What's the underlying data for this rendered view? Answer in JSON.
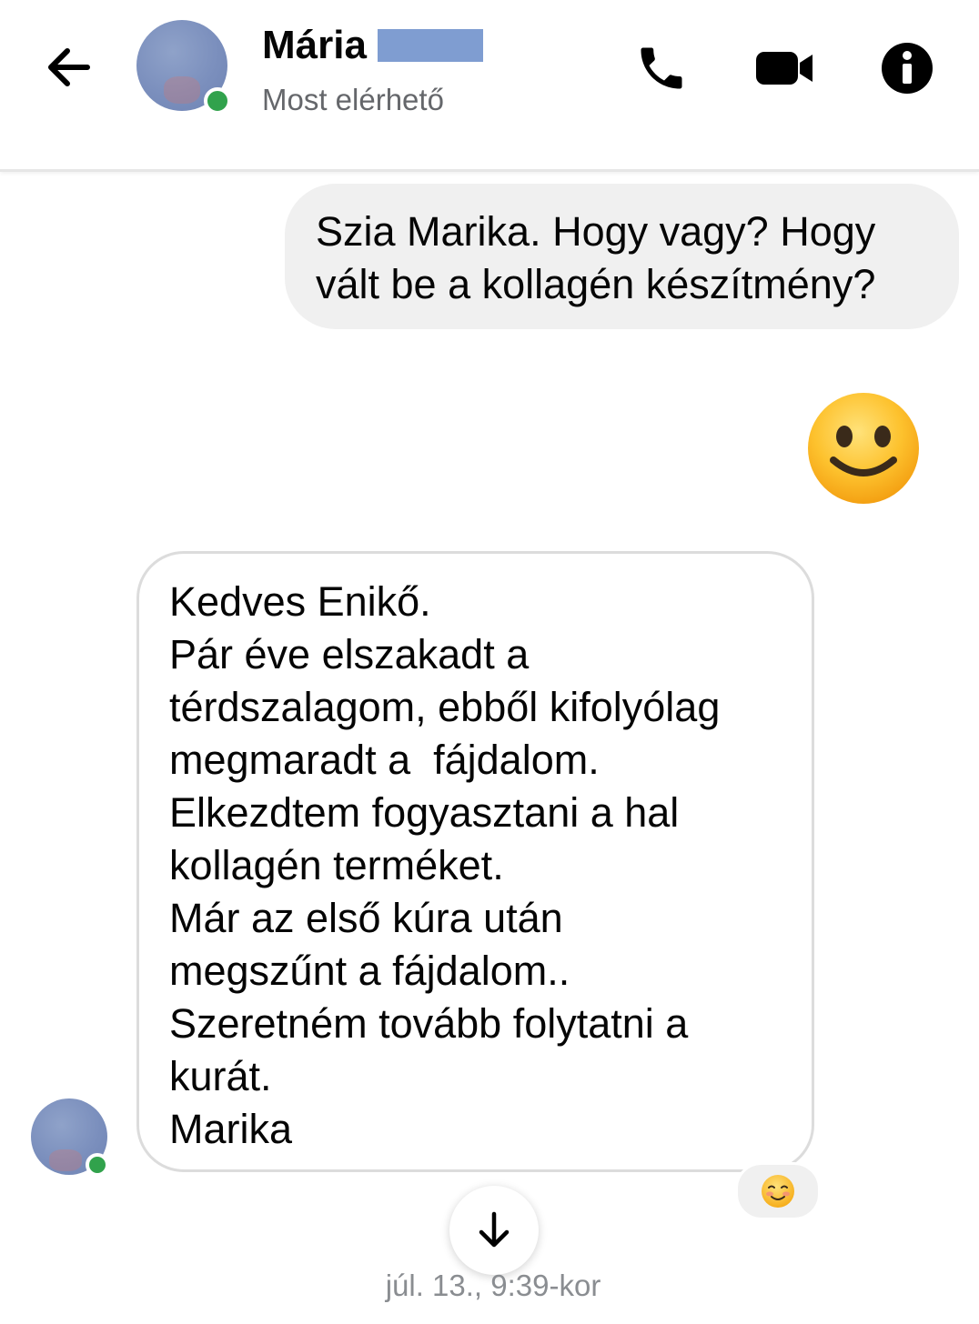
{
  "header": {
    "contact_name": "Mária",
    "status": "Most elérhető",
    "icons": {
      "back": "arrow-left-icon",
      "phone": "phone-icon",
      "video": "video-camera-icon",
      "info": "info-icon"
    },
    "accent_color": "#000000",
    "online_color": "#31a24c"
  },
  "conversation": {
    "outgoing_message": {
      "lines": [
        "Szia Marika. Hogy vagy? Hogy",
        "vált be a kollagén készítmény?"
      ]
    },
    "outgoing_sticker": "smiling-face-emoji",
    "incoming_message": {
      "lines": [
        "Kedves Enikő.",
        "Pár éve elszakadt a",
        "térdszalagom, ebből kifolyólag",
        "megmaradt a  fájdalom.",
        "Elkezdtem fogyasztani a hal",
        "kollagén terméket.",
        "Már az első kúra után",
        "megszűnt a fájdalom..",
        "Szeretném tovább folytatni a",
        "kurát.",
        "Marika"
      ]
    },
    "reaction": "smiling-face-with-blush-emoji",
    "timestamp": "júl. 13., 9:39-kor"
  },
  "scroll_button": "arrow-down-icon"
}
